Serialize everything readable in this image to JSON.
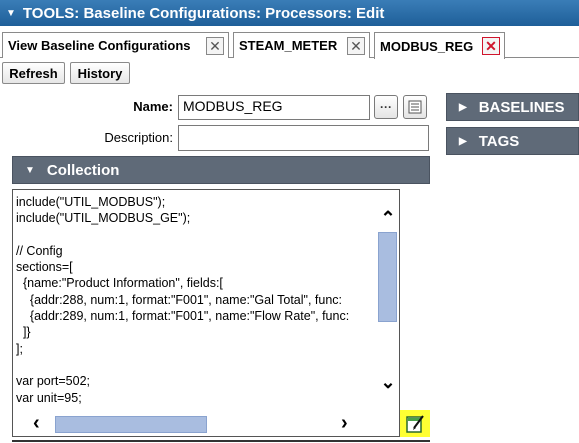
{
  "title": "TOOLS: Baseline Configurations: Processors: Edit",
  "tabs": [
    {
      "label": "View Baseline Configurations",
      "close": "✕"
    },
    {
      "label": "STEAM_METER",
      "close": "✕"
    },
    {
      "label": "MODBUS_REG",
      "close": "✕"
    }
  ],
  "toolbar": {
    "refresh": "Refresh",
    "history": "History"
  },
  "form": {
    "name_label": "Name:",
    "name_value": "MODBUS_REG",
    "browse_icon": "···",
    "description_label": "Description:",
    "description_value": ""
  },
  "collection": {
    "label": "Collection"
  },
  "side_panels": {
    "baselines": "BASELINES",
    "tags": "TAGS"
  },
  "code_text": "include(\"UTIL_MODBUS\");\ninclude(\"UTIL_MODBUS_GE\");\n\n// Config\nsections=[\n  {name:\"Product Information\", fields:[\n    {addr:288, num:1, format:\"F001\", name:\"Gal Total\", func:\n    {addr:289, num:1, format:\"F001\", name:\"Flow Rate\", func:\n  ]}\n];\n\nvar port=502;\nvar unit=95;",
  "colors": {
    "title_bar": "#1e5f99",
    "panel_header": "#5f6a78",
    "close_active": "#d0142c",
    "scroll_thumb": "#a9bde0",
    "highlight": "#ffff33"
  },
  "icons": [
    "triangle-down-icon",
    "close-icon",
    "ellipsis-icon",
    "list-icon",
    "triangle-right-icon",
    "chevron-up-icon",
    "chevron-down-icon",
    "chevron-left-icon",
    "chevron-right-icon",
    "edit-icon"
  ]
}
